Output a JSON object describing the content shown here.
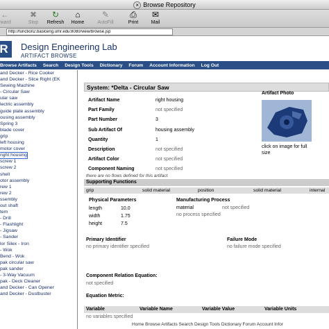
{
  "window": {
    "title": "Browse Repository"
  },
  "toolbar": [
    {
      "label": "rward",
      "icon": "←"
    },
    {
      "label": "Stop",
      "icon": "✖"
    },
    {
      "label": "Refresh",
      "icon": "↻"
    },
    {
      "label": "Home",
      "icon": "⌂"
    },
    {
      "label": "AutoFill",
      "icon": "✎"
    },
    {
      "label": "Print",
      "icon": "⎙"
    },
    {
      "label": "Mail",
      "icon": "✉"
    }
  ],
  "url": "http://function2.baslceng.umr.edu:8080/view/browse.jsp",
  "site": {
    "logo": "R",
    "title": "Design Engineering Lab",
    "subtitle": "ARTIFACT BROWSE"
  },
  "nav": [
    "Browse Artifacts",
    "Search",
    "Design Tools",
    "Dictionary",
    "Forum",
    "Account Information",
    "Log Out"
  ],
  "tree": [
    "and Decker - Rice Cooker",
    "and Decker - Slice Right (EK",
    "Sewing Machine",
    "- Circular Saw",
    "ular saw",
    "lectric assembly",
    "guide plate assembly",
    "ousing assembly",
    "Spring 3",
    "blade cover",
    "grip",
    "left housing",
    "motor cover",
    "right housing",
    "screw 1",
    "screw 2",
    "shell",
    "otor assembly",
    "rew 1",
    "rew 2",
    "ssembly",
    "out shaft",
    "tem",
    "- Drill",
    "- Flashlight",
    "- Jigsaw",
    "- Sander",
    "lor Silex - Iron",
    "- Wok",
    "Bend - Wok",
    "pak circular saw",
    "pak sander",
    "- 3-Way Vacuum",
    "pak - Deck Cleaner",
    "and Decker - Can Opener",
    "and Decker - Dustbuster"
  ],
  "system": "System: *Delta - Circular Saw",
  "fields": [
    {
      "label": "Artifact Name",
      "value": "right housing"
    },
    {
      "label": "Part Family",
      "value": "not specified"
    },
    {
      "label": "Part Number",
      "value": "3"
    },
    {
      "label": "Sub Artifact Of",
      "value": "housing assembly"
    },
    {
      "label": "Quantity",
      "value": "1"
    },
    {
      "label": "Description",
      "value": "not specified"
    },
    {
      "label": "Artifact Color",
      "value": "not specified"
    },
    {
      "label": "Component Naming",
      "value": "not specified"
    }
  ],
  "photo": {
    "label": "Artifact Photo",
    "caption1": "click on image for full",
    "caption2": "size"
  },
  "flows": "there are no flows defined for this artifact",
  "supporting": {
    "title": "Supporting Functions",
    "cells": [
      "grip",
      "solid material",
      "position",
      "solid material",
      "internal"
    ]
  },
  "physical": {
    "title": "Physical Parameters",
    "rows": [
      {
        "k": "length",
        "v": "10.0"
      },
      {
        "k": "width",
        "v": "1.75"
      },
      {
        "k": "height",
        "v": "7.5"
      }
    ]
  },
  "manufacturing": {
    "title": "Manufacturing Process",
    "material": "material",
    "material_value": "not specified",
    "note": "no process specified"
  },
  "primary": {
    "title": "Primary Identifier",
    "value": "no primary identifier specified"
  },
  "failure": {
    "title": "Failure Mode",
    "value": "no failure mode specified"
  },
  "relation": {
    "title": "Component Relation Equation:",
    "value": "not specified"
  },
  "metric": {
    "title": "Equation Metric:"
  },
  "vars": {
    "h1": "Variable",
    "h2": "Variable Name",
    "h3": "Variable Value",
    "h4": "Variable Units",
    "empty": "no variables specified"
  },
  "footer": "Home Browse Artifacts Search Design Tools Dictionary Forum Account Infor"
}
